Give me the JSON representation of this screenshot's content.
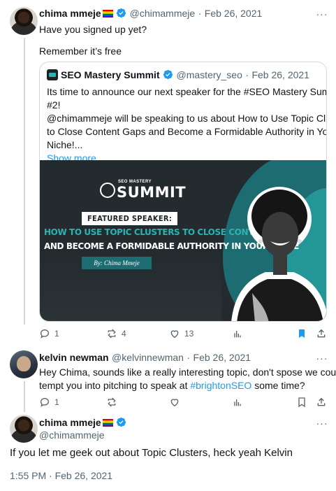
{
  "tweet1": {
    "display_name": "chima mmeje",
    "handle": "@chimammeje",
    "date": "Feb 26, 2021",
    "text_line1": "Have you signed up yet?",
    "text_line2": "Remember it’s free",
    "quote": {
      "display_name": "SEO Mastery Summit",
      "handle": "@mastery_seo",
      "date": "Feb 26, 2021",
      "lines": [
        "Its time to announce our next speaker for the #SEO Mastery Summit",
        "#2!",
        "@chimammeje will be speaking to us about How to Use Topic Clusters",
        "to Close Content Gaps and Become a Formidable Authority in Your",
        "Niche!..."
      ],
      "show_more": "Show more",
      "image": {
        "logo_small": "SEO MASTERY",
        "logo_big": "SUMMIT",
        "badge": "FEATURED SPEAKER:",
        "headline1": "HOW TO USE TOPIC CLUSTERS TO CLOSE CONTENT GAPS",
        "headline2": "AND BECOME A FORMIDABLE AUTHORITY IN YOUR NICHE",
        "byline": "By: Chima Mmeje"
      }
    },
    "actions": {
      "replies": "1",
      "retweets": "4",
      "likes": "13"
    }
  },
  "tweet2": {
    "display_name": "kelvin newman",
    "handle": "@kelvinnewman",
    "date": "Feb 26, 2021",
    "text_line1": "Hey Chima, sounds like a really interesting topic, don't spose we could",
    "text_line2_pre": "tempt you into pitching to speak at ",
    "hashtag": "#brightonSEO",
    "text_line2_post": " some time?",
    "actions": {
      "replies": "1",
      "retweets": "",
      "likes": ""
    }
  },
  "tweet3": {
    "display_name": "chima mmeje",
    "handle": "@chimammeje",
    "text": "If you let me geek out about Topic Clusters, heck yeah Kelvin",
    "timestamp": "1:55 PM · Feb 26, 2021"
  },
  "colors": {
    "accent": "#1d9bf0",
    "bookmark_active": "#1d9bf0",
    "muted": "#536471",
    "teal": "#2bb3b1"
  }
}
